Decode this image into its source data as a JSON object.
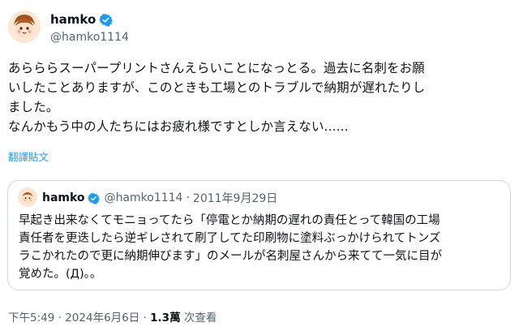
{
  "author": {
    "name": "hamko",
    "handle": "@hamko1114"
  },
  "body": {
    "text": "あらららスーパープリントさんえらいことになっとる。過去に名刺をお願\nいしたことありますが、このときも工場とのトラブルで納期が遅れたりし\nました。\nなんかもう中の人たちにはお疲れ様ですとしか言えない......"
  },
  "translate_label": "翻譯貼文",
  "quote": {
    "name": "hamko",
    "handle": "@hamko1114",
    "separator": "·",
    "date": "2011年9月29日",
    "text": "早起き出来なくてモニョってたら「停電とか納期の遅れの責任とって韓国の工場\n責任者を更迭したら逆ギレされて刷了してた印刷物に塗料ぶっかけられてトンズ\nラこかれたので更に納期伸びます」のメールが名刺屋さんから来てて一気に目が\n覚めた。(Д)。。"
  },
  "footer": {
    "time": "下午5:49",
    "separator1": "·",
    "date": "2024年6月6日",
    "separator2": "·",
    "views_count": "1.3萬",
    "views_label": "次查看"
  },
  "colors": {
    "verified": "#1d9bf0",
    "link": "#1d9bf0",
    "muted": "#536471"
  },
  "icons": {
    "verified": "verified-badge-icon",
    "avatar": "cartoon-boy-avatar"
  }
}
